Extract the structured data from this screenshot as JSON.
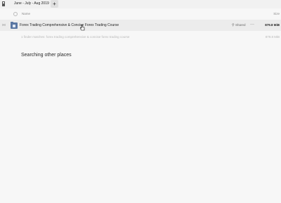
{
  "tab": {
    "title": "June - July - Aug 2019",
    "new_tab_label": "+"
  },
  "columns": {
    "name": "Name",
    "size": "Size"
  },
  "file_row": {
    "name": "Forex Trading Comprehensive & Concise Forex Trading Course",
    "share_label": "Shared",
    "more_label": "···",
    "size": "879.8 MiB"
  },
  "search": {
    "matches_text": "1 finder matches: forex trading comprehensive & concise forex trading course",
    "matches_size": "879.8 MiB",
    "other_places_label": "Searching other places"
  },
  "colors": {
    "background": "#f7f7f7",
    "row_highlight": "#ececec",
    "folder_icon": "#5a77a3"
  },
  "icons": {
    "app": "app-icon",
    "folder": "folder-icon",
    "link": "link-icon",
    "cursor": "pointer-cursor-icon"
  }
}
